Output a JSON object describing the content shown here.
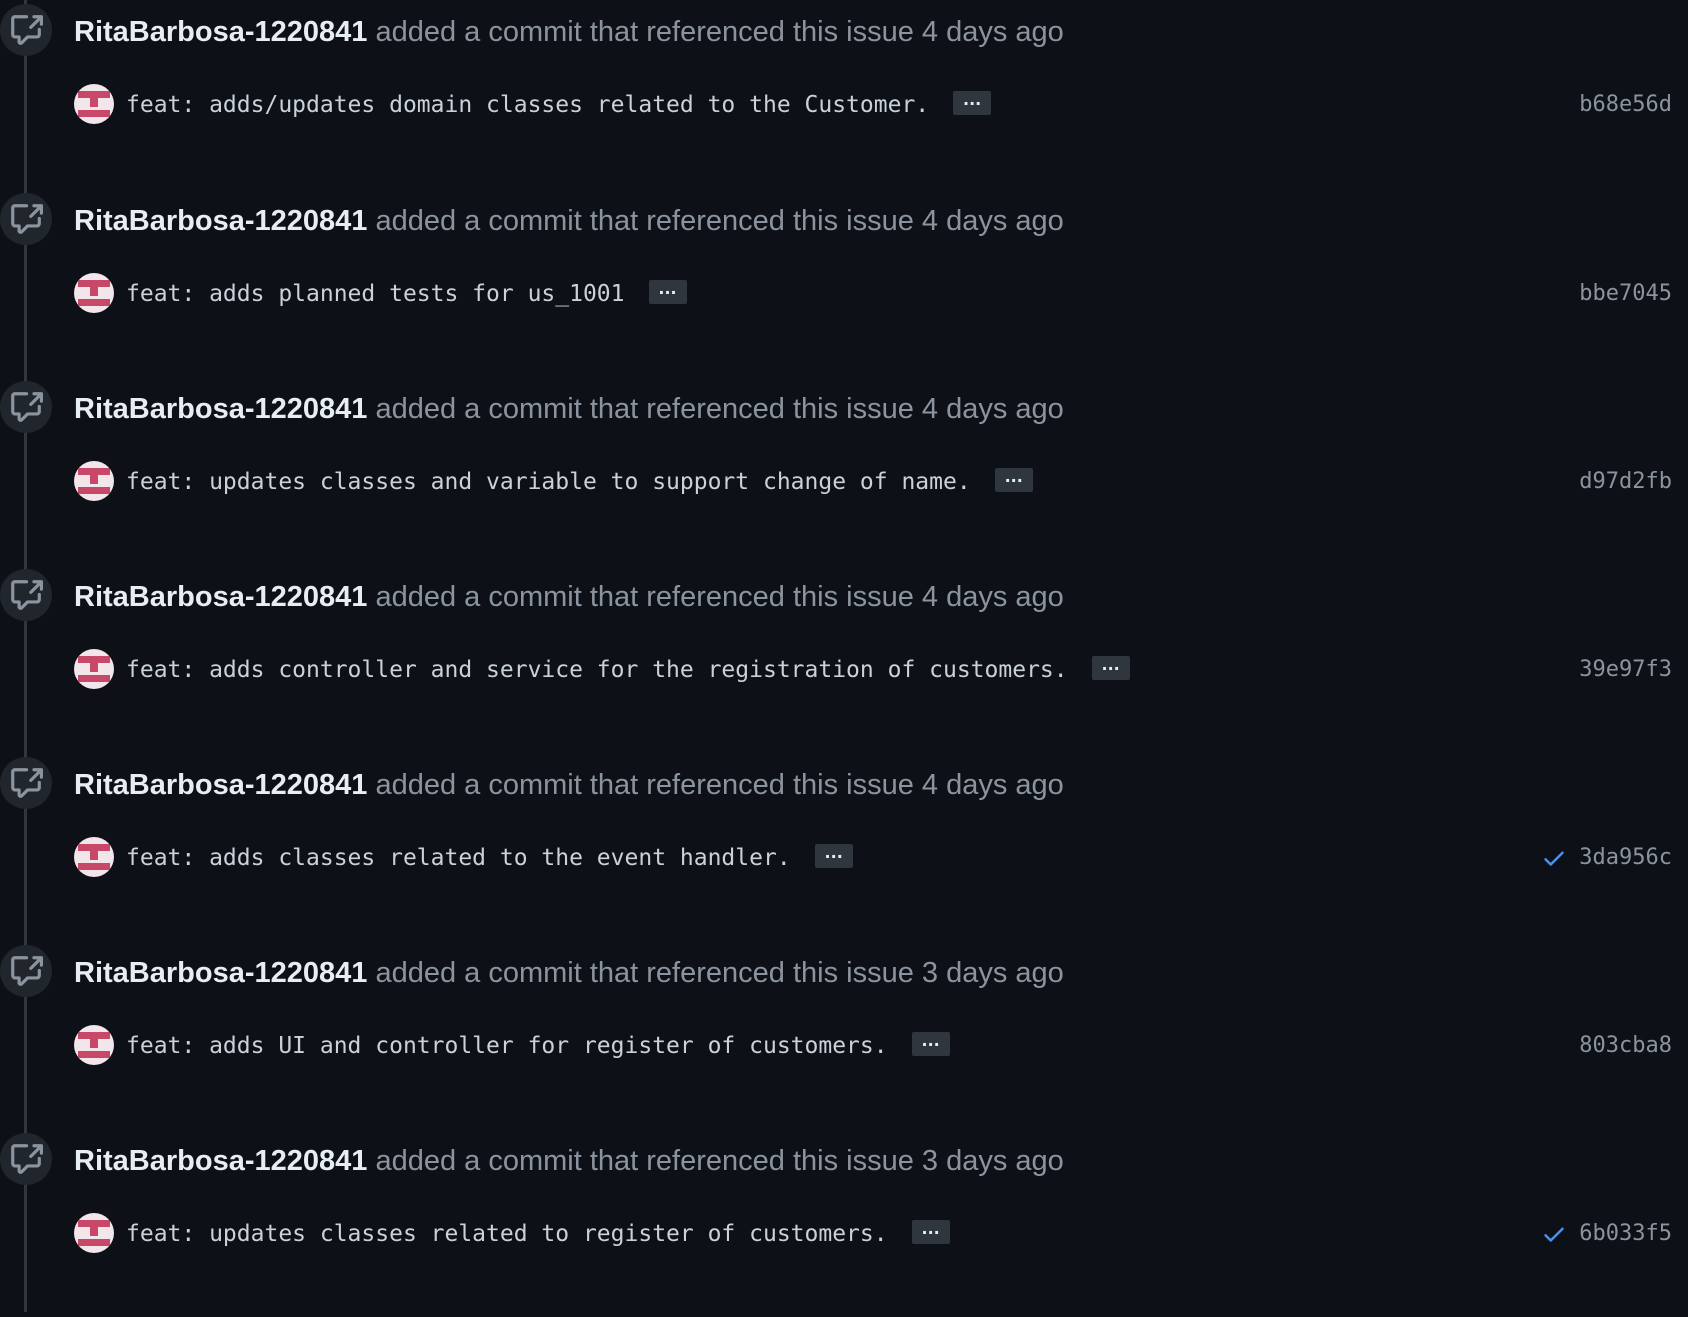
{
  "events": [
    {
      "author": "RitaBarbosa-1220841",
      "action": "added a commit that referenced this issue",
      "time": "4 days ago",
      "message": "feat: adds/updates domain classes related to the Customer.",
      "ellipsis": "...",
      "sha": "b68e56d",
      "verified": false
    },
    {
      "author": "RitaBarbosa-1220841",
      "action": "added a commit that referenced this issue",
      "time": "4 days ago",
      "message": "feat: adds planned tests for us_1001",
      "ellipsis": "...",
      "sha": "bbe7045",
      "verified": false
    },
    {
      "author": "RitaBarbosa-1220841",
      "action": "added a commit that referenced this issue",
      "time": "4 days ago",
      "message": "feat: updates classes and variable to support change of name.",
      "ellipsis": "...",
      "sha": "d97d2fb",
      "verified": false
    },
    {
      "author": "RitaBarbosa-1220841",
      "action": "added a commit that referenced this issue",
      "time": "4 days ago",
      "message": "feat: adds controller and service for the registration of customers.",
      "ellipsis": "...",
      "sha": "39e97f3",
      "verified": false
    },
    {
      "author": "RitaBarbosa-1220841",
      "action": "added a commit that referenced this issue",
      "time": "4 days ago",
      "message": "feat: adds classes related to the event handler.",
      "ellipsis": "...",
      "sha": "3da956c",
      "verified": true
    },
    {
      "author": "RitaBarbosa-1220841",
      "action": "added a commit that referenced this issue",
      "time": "3 days ago",
      "message": "feat: adds UI and controller for register of customers.",
      "ellipsis": "...",
      "sha": "803cba8",
      "verified": false
    },
    {
      "author": "RitaBarbosa-1220841",
      "action": "added a commit that referenced this issue",
      "time": "3 days ago",
      "message": "feat: updates classes related to register of customers.",
      "ellipsis": "...",
      "sha": "6b033f5",
      "verified": true
    }
  ],
  "colors": {
    "background": "#0d1117",
    "author": "#e6edf3",
    "muted": "#8b949e",
    "check": "#4493f8",
    "avatar_primary": "#c8486a",
    "avatar_light": "#f3e6ea"
  },
  "icons": {
    "event_badge": "cross-reference-icon",
    "verified": "check-icon",
    "avatar": "identicon-avatar"
  }
}
